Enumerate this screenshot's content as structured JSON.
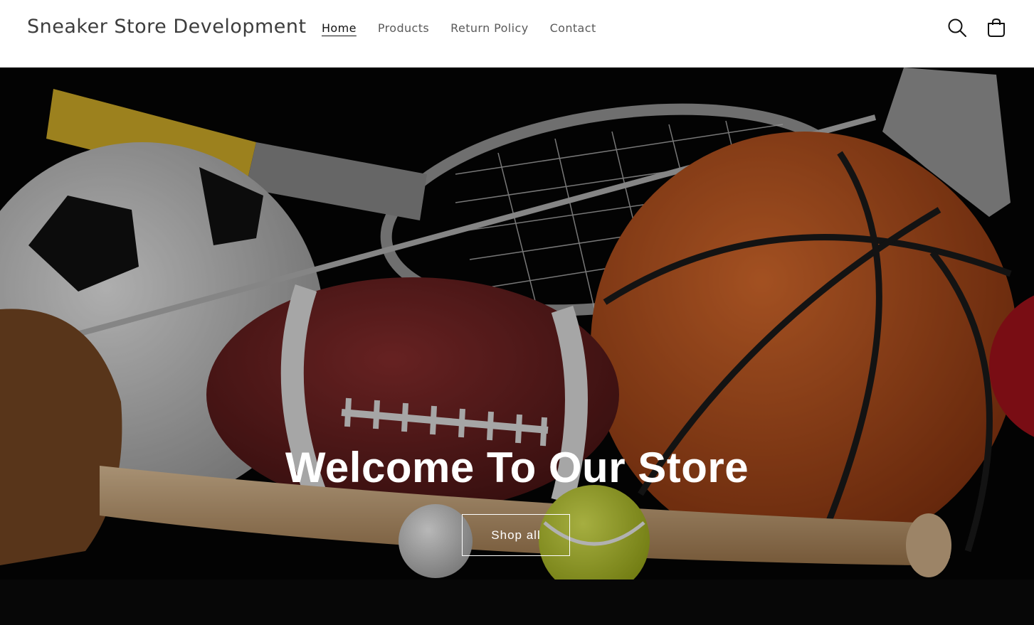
{
  "header": {
    "store_title": "Sneaker Store Development",
    "nav": [
      {
        "label": "Home",
        "active": true
      },
      {
        "label": "Products",
        "active": false
      },
      {
        "label": "Return Policy",
        "active": false
      },
      {
        "label": "Contact",
        "active": false
      }
    ],
    "icons": {
      "search": "search-icon",
      "cart": "cart-icon"
    }
  },
  "hero": {
    "title": "Welcome To Our Store",
    "button_label": "Shop all"
  }
}
